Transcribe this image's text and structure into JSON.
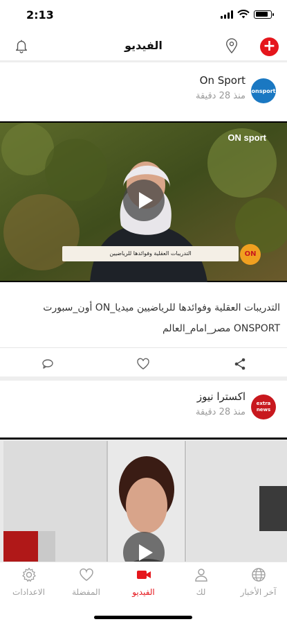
{
  "status_bar": {
    "time": "2:13",
    "battery_level": 0.85
  },
  "header": {
    "title": "الفيديو"
  },
  "feed": {
    "cards": [
      {
        "source": "On Sport",
        "avatar_text": "onsport",
        "avatar_color": "#1a78c2",
        "time": "منذ 28 دقيقة",
        "overlay_logo": "ON sport",
        "lower_third": "التدريبات العقلية وفوائدها للرياضيين",
        "lower_third_badge": "ON",
        "text_line1": "التدريبات العقلية وفوائدها للرياضيين ميديا_ON أون_سبورت",
        "text_line2": "ONSPORT مصر_امام_العالم"
      },
      {
        "source": "اكسترا نيوز",
        "avatar_text": "extra news",
        "avatar_color": "#c8181e",
        "time": "منذ 28 دقيقة"
      }
    ]
  },
  "tabs": [
    {
      "label": "الاعدادات",
      "icon": "settings-icon",
      "active": false
    },
    {
      "label": "المفضلة",
      "icon": "heart-icon",
      "active": false
    },
    {
      "label": "الفيديو",
      "icon": "video-camera-icon",
      "active": true
    },
    {
      "label": "لك",
      "icon": "user-icon",
      "active": false
    },
    {
      "label": "آخر الأخبار",
      "icon": "globe-icon",
      "active": false
    }
  ],
  "colors": {
    "accent": "#e5161c",
    "inactive": "#a0a0a0"
  }
}
